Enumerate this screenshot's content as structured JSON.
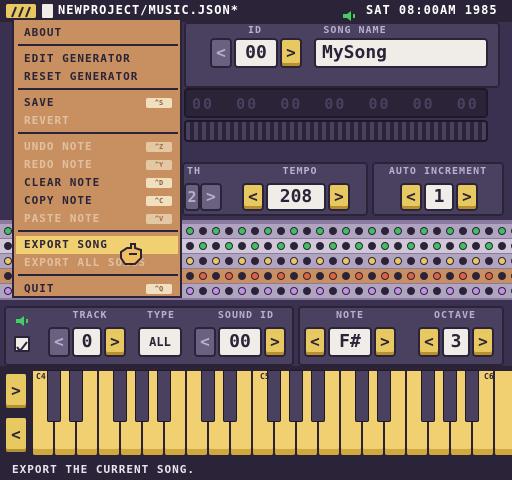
{
  "topbar": {
    "file_title": "NEWPROJECT/MUSIC.JSON*",
    "datetime": "SAT 08:00AM 1985"
  },
  "menu": {
    "items": [
      {
        "label": "ABOUT",
        "shortcut": "",
        "disabled": false
      },
      {
        "label": "EDIT GENERATOR",
        "shortcut": "",
        "disabled": false
      },
      {
        "label": "RESET GENERATOR",
        "shortcut": "",
        "disabled": false
      },
      {
        "label": "SAVE",
        "shortcut": "^S",
        "disabled": false
      },
      {
        "label": "REVERT",
        "shortcut": "",
        "disabled": true
      },
      {
        "label": "UNDO NOTE",
        "shortcut": "^Z",
        "disabled": true
      },
      {
        "label": "REDO NOTE",
        "shortcut": "^Y",
        "disabled": true
      },
      {
        "label": "CLEAR NOTE",
        "shortcut": "^D",
        "disabled": false
      },
      {
        "label": "COPY NOTE",
        "shortcut": "^C",
        "disabled": false
      },
      {
        "label": "PASTE NOTE",
        "shortcut": "^V",
        "disabled": true
      },
      {
        "label": "EXPORT SONG",
        "shortcut": "",
        "disabled": false,
        "highlighted": true
      },
      {
        "label": "EXPORT ALL SONGS",
        "shortcut": "",
        "disabled": true
      },
      {
        "label": "QUIT",
        "shortcut": "^Q",
        "disabled": false
      }
    ]
  },
  "song": {
    "id_label": "ID",
    "id_value": "00",
    "name_label": "SONG NAME",
    "name_value": "MySong"
  },
  "pattern_values": [
    "00",
    "00",
    "00",
    "00",
    "00",
    "00",
    "00",
    "00",
    "00"
  ],
  "tempo": {
    "label": "TEMPO",
    "value": "208",
    "partial_label": "TH",
    "partial_value": "2"
  },
  "auto_increment": {
    "label": "AUTO INCREMENT",
    "value": "1"
  },
  "track_panel": {
    "track_label": "TRACK",
    "track_value": "0",
    "type_label": "TYPE",
    "type_value": "ALL",
    "sound_label": "SOUND ID",
    "sound_value": "00"
  },
  "note_panel": {
    "note_label": "NOTE",
    "note_value": "F#",
    "octave_label": "OCTAVE",
    "octave_value": "3"
  },
  "piano": {
    "octave_labels": [
      "C4",
      "C5",
      "C6"
    ]
  },
  "status": {
    "text": "EXPORT THE CURRENT SONG."
  },
  "icons": {
    "app": "chiptune-logo-icon",
    "file": "file-icon",
    "speaker": "speaker-icon",
    "cursor": "hand-cursor-icon"
  },
  "colors": {
    "accent": "#e8c860",
    "menu": "#c89060",
    "highlight": "#f0d070",
    "bg": "#3a3050"
  }
}
